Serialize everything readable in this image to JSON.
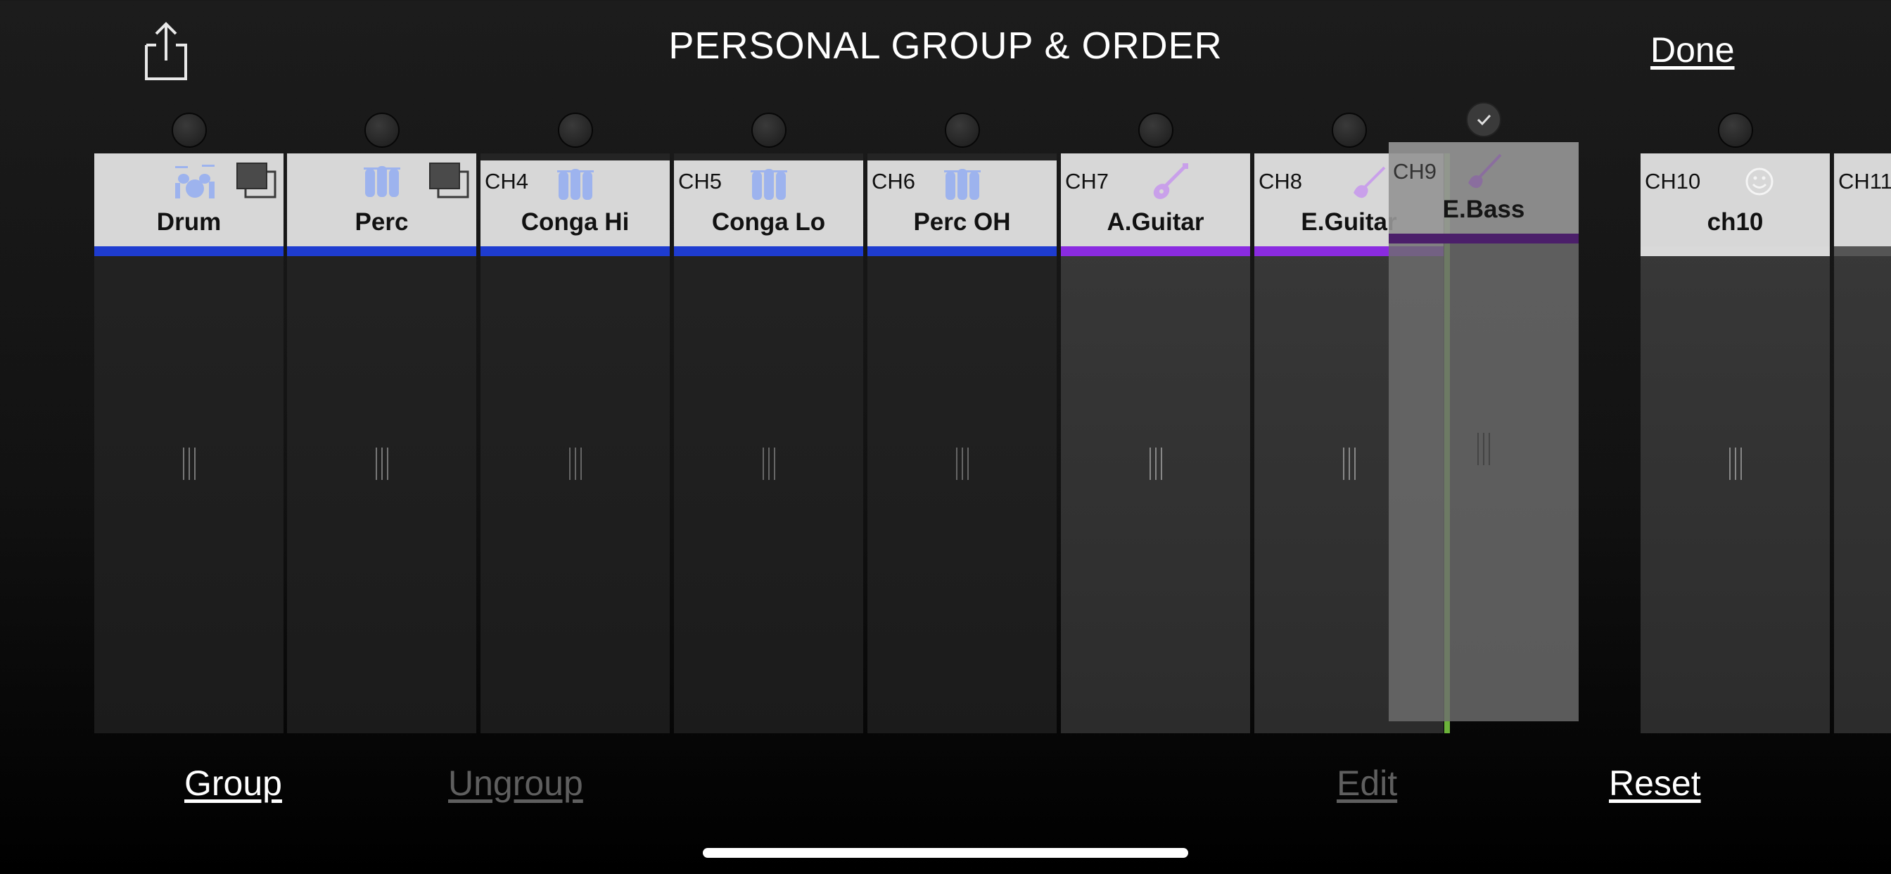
{
  "header": {
    "title": "PERSONAL GROUP & ORDER",
    "done_label": "Done"
  },
  "strips": [
    {
      "channel": "",
      "name": "Drum",
      "icon": "drum-kit-icon",
      "group": true,
      "color": "#1e3cd0"
    },
    {
      "channel": "",
      "name": "Perc",
      "icon": "percussion-icon",
      "group": true,
      "color": "#1e3cd0"
    },
    {
      "channel": "CH4",
      "name": "Conga Hi",
      "icon": "conga-icon",
      "group": false,
      "color": "#1e3cd0"
    },
    {
      "channel": "CH5",
      "name": "Conga Lo",
      "icon": "conga-icon",
      "group": false,
      "color": "#1e3cd0"
    },
    {
      "channel": "CH6",
      "name": "Perc OH",
      "icon": "conga-icon",
      "group": false,
      "color": "#1e3cd0"
    },
    {
      "channel": "CH7",
      "name": "A.Guitar",
      "icon": "acoustic-guitar-icon",
      "group": false,
      "color": "#8a2be0"
    },
    {
      "channel": "CH8",
      "name": "E.Guitar",
      "icon": "electric-guitar-icon",
      "group": false,
      "color": "#8a2be0"
    },
    {
      "channel": "CH10",
      "name": "ch10",
      "icon": "smiley-icon",
      "group": false,
      "color": "#d9d9d9"
    },
    {
      "channel": "CH11",
      "name": "",
      "icon": "",
      "group": false,
      "color": "#555555"
    }
  ],
  "dragging": {
    "channel": "CH9",
    "name": "E.Bass",
    "icon": "bass-guitar-icon",
    "color": "#4b1f6a"
  },
  "footer": {
    "group_label": "Group",
    "ungroup_label": "Ungroup",
    "edit_label": "Edit",
    "reset_label": "Reset"
  },
  "colors": {
    "accent_insert": "#6cb33a",
    "blue": "#1e3cd0",
    "purple": "#8a2be0"
  }
}
